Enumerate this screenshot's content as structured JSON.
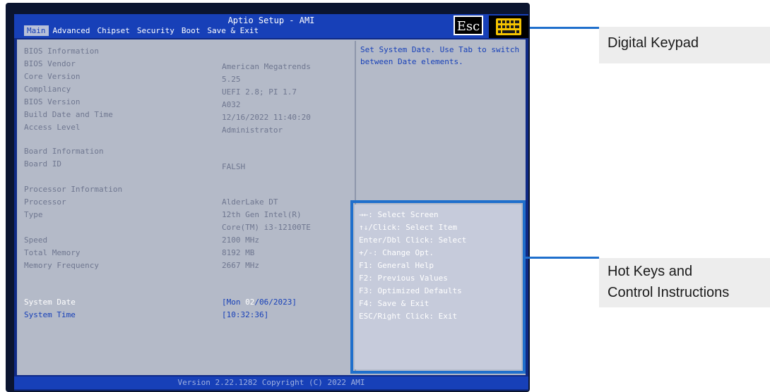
{
  "bios": {
    "title": "Aptio Setup - AMI",
    "tabs": [
      "Main",
      "Advanced",
      "Chipset",
      "Security",
      "Boot",
      "Save & Exit"
    ],
    "active_tab": "Main",
    "esc_label": "Esc",
    "rows": [
      {
        "label": "BIOS Information",
        "value": ""
      },
      {
        "label": "BIOS Vendor",
        "value": "American Megatrends"
      },
      {
        "label": "Core Version",
        "value": "5.25"
      },
      {
        "label": "Compliancy",
        "value": "UEFI 2.8; PI 1.7"
      },
      {
        "label": "BIOS Version",
        "value": "A032"
      },
      {
        "label": "Build Date and Time",
        "value": "12/16/2022 11:40:20"
      },
      {
        "label": "Access Level",
        "value": "Administrator"
      },
      {
        "label": "Board Information",
        "value": ""
      },
      {
        "label": "Board ID",
        "value": "FALSH"
      },
      {
        "label": "Processor Information",
        "value": ""
      },
      {
        "label": "Processor",
        "value": "AlderLake DT"
      },
      {
        "label": "Type",
        "value": "12th Gen Intel(R)"
      },
      {
        "label": "",
        "value": "Core(TM) i3-12100TE"
      },
      {
        "label": "Speed",
        "value": "2100 MHz"
      },
      {
        "label": "Total Memory",
        "value": "8192 MB"
      },
      {
        "label": "Memory Frequency",
        "value": " 2667 MHz"
      }
    ],
    "system_date": {
      "label": "System Date",
      "value_pre": "[Mon ",
      "value_sel": "02",
      "value_post": "/06/2023]"
    },
    "system_time": {
      "label": "System Time",
      "value": "[10:32:36]"
    },
    "help_text": "Set System Date. Use Tab to switch between Date elements.",
    "hotkeys": [
      "→←: Select Screen",
      "↑↓/Click: Select Item",
      "Enter/Dbl Click: Select",
      "+/-: Change Opt.",
      "F1: General Help",
      "F2: Previous Values",
      "F3: Optimized Defaults",
      "F4: Save & Exit",
      "ESC/Right Click: Exit"
    ],
    "version": "Version 2.22.1282 Copyright (C) 2022 AMI"
  },
  "callouts": {
    "keypad": "Digital Keypad",
    "hotkeys_line1": "Hot Keys and",
    "hotkeys_line2": "Control Instructions"
  },
  "colors": {
    "bios_blue": "#1740b8",
    "panel_gray": "#b4bac8",
    "callout_blue": "#1f6fcc"
  },
  "icons": [
    "esc-key",
    "keypad-icon"
  ]
}
